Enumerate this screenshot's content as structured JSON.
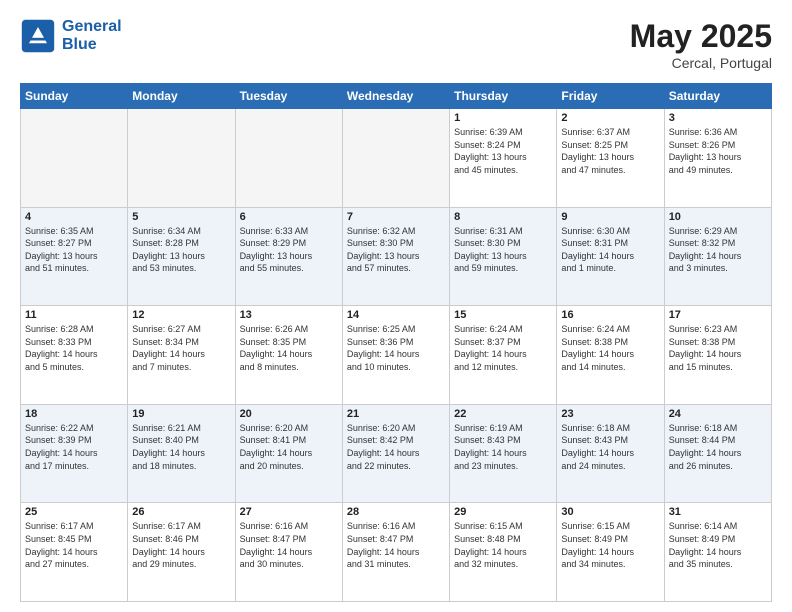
{
  "header": {
    "logo_line1": "General",
    "logo_line2": "Blue",
    "month_year": "May 2025",
    "location": "Cercal, Portugal"
  },
  "weekdays": [
    "Sunday",
    "Monday",
    "Tuesday",
    "Wednesday",
    "Thursday",
    "Friday",
    "Saturday"
  ],
  "weeks": [
    [
      {
        "day": "",
        "info": ""
      },
      {
        "day": "",
        "info": ""
      },
      {
        "day": "",
        "info": ""
      },
      {
        "day": "",
        "info": ""
      },
      {
        "day": "1",
        "info": "Sunrise: 6:39 AM\nSunset: 8:24 PM\nDaylight: 13 hours\nand 45 minutes."
      },
      {
        "day": "2",
        "info": "Sunrise: 6:37 AM\nSunset: 8:25 PM\nDaylight: 13 hours\nand 47 minutes."
      },
      {
        "day": "3",
        "info": "Sunrise: 6:36 AM\nSunset: 8:26 PM\nDaylight: 13 hours\nand 49 minutes."
      }
    ],
    [
      {
        "day": "4",
        "info": "Sunrise: 6:35 AM\nSunset: 8:27 PM\nDaylight: 13 hours\nand 51 minutes."
      },
      {
        "day": "5",
        "info": "Sunrise: 6:34 AM\nSunset: 8:28 PM\nDaylight: 13 hours\nand 53 minutes."
      },
      {
        "day": "6",
        "info": "Sunrise: 6:33 AM\nSunset: 8:29 PM\nDaylight: 13 hours\nand 55 minutes."
      },
      {
        "day": "7",
        "info": "Sunrise: 6:32 AM\nSunset: 8:30 PM\nDaylight: 13 hours\nand 57 minutes."
      },
      {
        "day": "8",
        "info": "Sunrise: 6:31 AM\nSunset: 8:30 PM\nDaylight: 13 hours\nand 59 minutes."
      },
      {
        "day": "9",
        "info": "Sunrise: 6:30 AM\nSunset: 8:31 PM\nDaylight: 14 hours\nand 1 minute."
      },
      {
        "day": "10",
        "info": "Sunrise: 6:29 AM\nSunset: 8:32 PM\nDaylight: 14 hours\nand 3 minutes."
      }
    ],
    [
      {
        "day": "11",
        "info": "Sunrise: 6:28 AM\nSunset: 8:33 PM\nDaylight: 14 hours\nand 5 minutes."
      },
      {
        "day": "12",
        "info": "Sunrise: 6:27 AM\nSunset: 8:34 PM\nDaylight: 14 hours\nand 7 minutes."
      },
      {
        "day": "13",
        "info": "Sunrise: 6:26 AM\nSunset: 8:35 PM\nDaylight: 14 hours\nand 8 minutes."
      },
      {
        "day": "14",
        "info": "Sunrise: 6:25 AM\nSunset: 8:36 PM\nDaylight: 14 hours\nand 10 minutes."
      },
      {
        "day": "15",
        "info": "Sunrise: 6:24 AM\nSunset: 8:37 PM\nDaylight: 14 hours\nand 12 minutes."
      },
      {
        "day": "16",
        "info": "Sunrise: 6:24 AM\nSunset: 8:38 PM\nDaylight: 14 hours\nand 14 minutes."
      },
      {
        "day": "17",
        "info": "Sunrise: 6:23 AM\nSunset: 8:38 PM\nDaylight: 14 hours\nand 15 minutes."
      }
    ],
    [
      {
        "day": "18",
        "info": "Sunrise: 6:22 AM\nSunset: 8:39 PM\nDaylight: 14 hours\nand 17 minutes."
      },
      {
        "day": "19",
        "info": "Sunrise: 6:21 AM\nSunset: 8:40 PM\nDaylight: 14 hours\nand 18 minutes."
      },
      {
        "day": "20",
        "info": "Sunrise: 6:20 AM\nSunset: 8:41 PM\nDaylight: 14 hours\nand 20 minutes."
      },
      {
        "day": "21",
        "info": "Sunrise: 6:20 AM\nSunset: 8:42 PM\nDaylight: 14 hours\nand 22 minutes."
      },
      {
        "day": "22",
        "info": "Sunrise: 6:19 AM\nSunset: 8:43 PM\nDaylight: 14 hours\nand 23 minutes."
      },
      {
        "day": "23",
        "info": "Sunrise: 6:18 AM\nSunset: 8:43 PM\nDaylight: 14 hours\nand 24 minutes."
      },
      {
        "day": "24",
        "info": "Sunrise: 6:18 AM\nSunset: 8:44 PM\nDaylight: 14 hours\nand 26 minutes."
      }
    ],
    [
      {
        "day": "25",
        "info": "Sunrise: 6:17 AM\nSunset: 8:45 PM\nDaylight: 14 hours\nand 27 minutes."
      },
      {
        "day": "26",
        "info": "Sunrise: 6:17 AM\nSunset: 8:46 PM\nDaylight: 14 hours\nand 29 minutes."
      },
      {
        "day": "27",
        "info": "Sunrise: 6:16 AM\nSunset: 8:47 PM\nDaylight: 14 hours\nand 30 minutes."
      },
      {
        "day": "28",
        "info": "Sunrise: 6:16 AM\nSunset: 8:47 PM\nDaylight: 14 hours\nand 31 minutes."
      },
      {
        "day": "29",
        "info": "Sunrise: 6:15 AM\nSunset: 8:48 PM\nDaylight: 14 hours\nand 32 minutes."
      },
      {
        "day": "30",
        "info": "Sunrise: 6:15 AM\nSunset: 8:49 PM\nDaylight: 14 hours\nand 34 minutes."
      },
      {
        "day": "31",
        "info": "Sunrise: 6:14 AM\nSunset: 8:49 PM\nDaylight: 14 hours\nand 35 minutes."
      }
    ]
  ]
}
